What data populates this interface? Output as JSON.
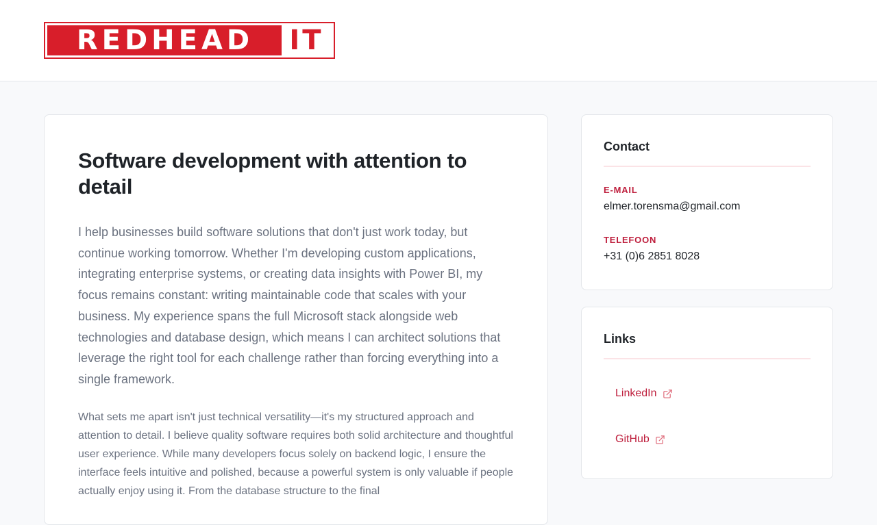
{
  "brand": {
    "logo_red_text": "REDHEAD",
    "logo_white_text": "IT",
    "primary_color": "#d81e2a",
    "accent_color": "#be1e3c"
  },
  "main": {
    "title": "Software development with attention to detail",
    "lead": "I help businesses build software solutions that don't just work today, but continue working tomorrow. Whether I'm developing custom applications, integrating enterprise systems, or creating data insights with Power BI, my focus remains constant: writing maintainable code that scales with your business. My experience spans the full Microsoft stack alongside web technologies and database design, which means I can architect solutions that leverage the right tool for each challenge rather than forcing everything into a single framework.",
    "body": "What sets me apart isn't just technical versatility—it's my structured approach and attention to detail. I believe quality software requires both solid architecture and thoughtful user experience. While many developers focus solely on backend logic, I ensure the interface feels intuitive and polished, because a powerful system is only valuable if people actually enjoy using it. From the database structure to the final"
  },
  "contact": {
    "title": "Contact",
    "email_label": "E-MAIL",
    "email_value": "elmer.torensma@gmail.com",
    "phone_label": "TELEFOON",
    "phone_value": "+31 (0)6 2851 8028"
  },
  "links": {
    "title": "Links",
    "items": [
      {
        "label": "LinkedIn",
        "icon": "external-link-icon"
      },
      {
        "label": "GitHub",
        "icon": "external-link-icon"
      }
    ]
  }
}
